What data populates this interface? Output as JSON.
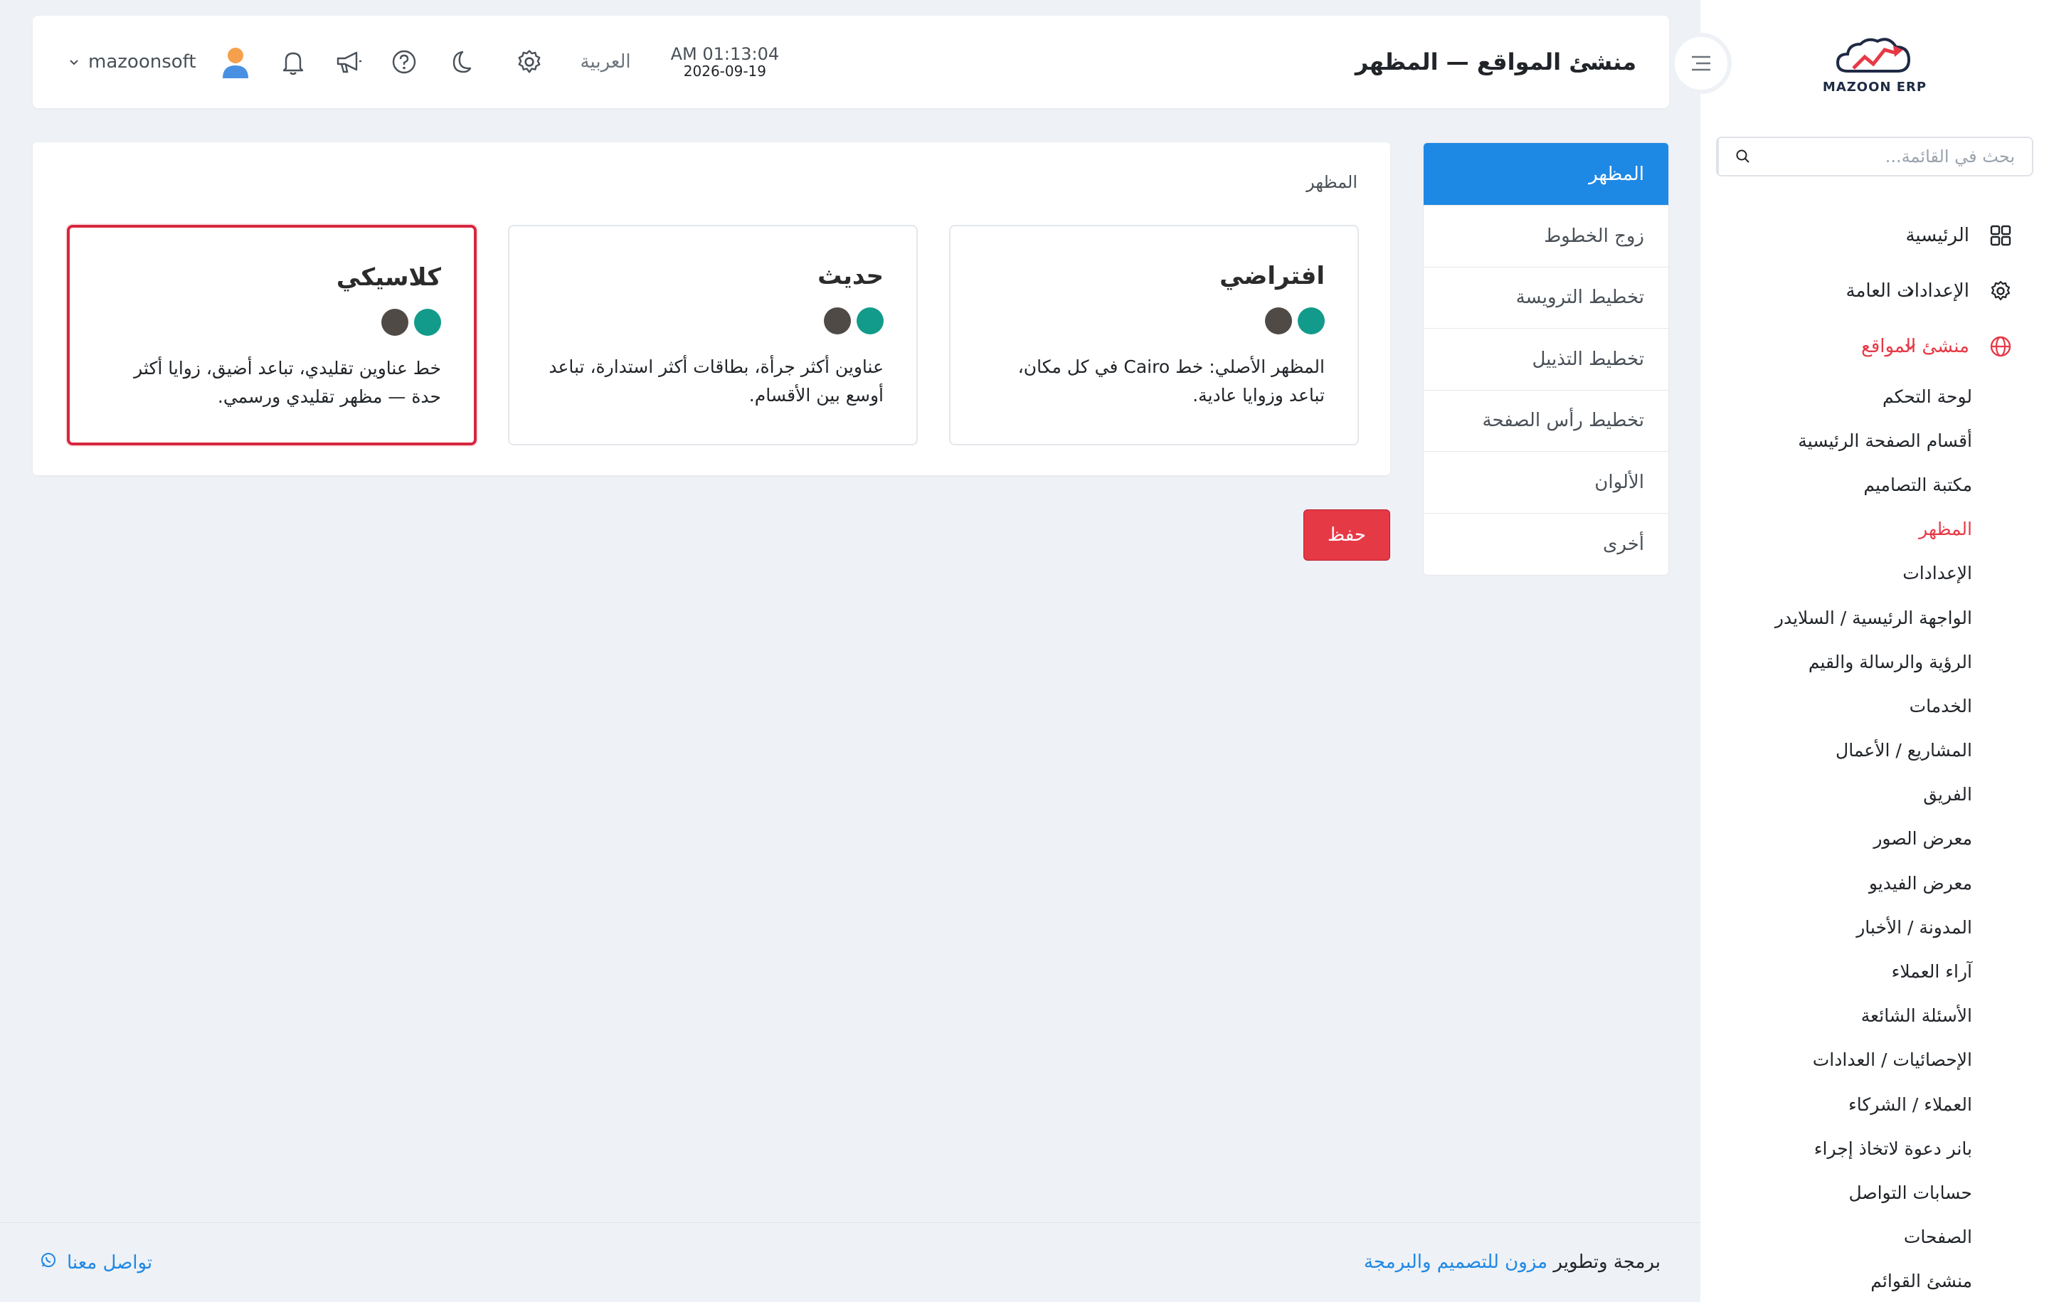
{
  "brand": {
    "logo_text": "MAZOON ERP"
  },
  "sidebar": {
    "search_placeholder": "بحث في القائمة...",
    "items": [
      {
        "label": "الرئيسية",
        "icon": "grid-icon"
      },
      {
        "label": "الإعدادات العامة",
        "icon": "gear-icon"
      },
      {
        "label": "منشئ المواقع",
        "icon": "globe-icon"
      }
    ],
    "sub_items": [
      "لوحة التحكم",
      "أقسام الصفحة الرئيسية",
      "مكتبة التصاميم",
      "المظهر",
      "الإعدادات",
      "الواجهة الرئيسية / السلايدر",
      "الرؤية والرسالة والقيم",
      "الخدمات",
      "المشاريع / الأعمال",
      "الفريق",
      "معرض الصور",
      "معرض الفيديو",
      "المدونة / الأخبار",
      "آراء العملاء",
      "الأسئلة الشائعة",
      "الإحصائيات / العدادات",
      "العملاء / الشركاء",
      "بانر دعوة لاتخاذ إجراء",
      "حسابات التواصل",
      "الصفحات",
      "منشئ القوائم"
    ]
  },
  "header": {
    "title": "منشئ المواقع — المظهر",
    "time": "AM 01:13:04",
    "date": "2026-09-19",
    "language": "العربية",
    "username": "mazoonsoft"
  },
  "tabs": [
    "المظهر",
    "زوج الخطوط",
    "تخطيط الترويسة",
    "تخطيط التذييل",
    "تخطيط رأس الصفحة",
    "الألوان",
    "أخرى"
  ],
  "main": {
    "section_label": "المظهر",
    "themes": [
      {
        "name": "افتراضي",
        "desc": "المظهر الأصلي: خط Cairo في كل مكان، تباعد وزوايا عادية.",
        "colors": [
          "#129b8a",
          "#4f4a45"
        ]
      },
      {
        "name": "حديث",
        "desc": "عناوين أكثر جرأة، بطاقات أكثر استدارة، تباعد أوسع بين الأقسام.",
        "colors": [
          "#129b8a",
          "#4f4a45"
        ]
      },
      {
        "name": "كلاسيكي",
        "desc": "خط عناوين تقليدي، تباعد أضيق، زوايا أكثر حدة — مظهر تقليدي ورسمي.",
        "colors": [
          "#129b8a",
          "#4f4a45"
        ]
      }
    ],
    "save_label": "حفظ"
  },
  "footer": {
    "prefix": "برمجة وتطوير",
    "company": "مزون للتصميم والبرمجة",
    "contact": "تواصل معنا"
  },
  "colors": {
    "accent": "#e63946",
    "primary": "#1e88e5",
    "background": "#eef1f5"
  }
}
